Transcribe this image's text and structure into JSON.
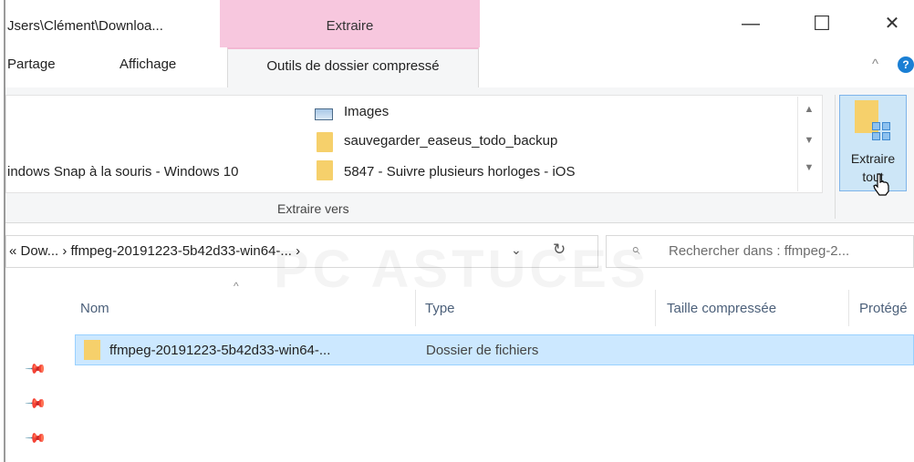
{
  "window": {
    "title": "Jsers\\Clément\\Downloa...",
    "context_tab": "Extraire",
    "minimize": "—",
    "maximize": "☐",
    "close": "✕"
  },
  "tabs": {
    "share": "Partage",
    "view": "Affichage",
    "active": "Outils de dossier compressé",
    "collapse": "^",
    "help": "?"
  },
  "ribbon": {
    "items": [
      {
        "label": "Images",
        "icon": "pictures-icon"
      },
      {
        "label": "sauvegarder_easeus_todo_backup",
        "icon": "folder-icon"
      },
      {
        "label": "5847 - Suivre plusieurs horloges - iOS",
        "icon": "folder-icon"
      }
    ],
    "left_item": "indows Snap à la souris - Windows 10",
    "group_label": "Extraire vers",
    "extract_all_line1": "Extraire",
    "extract_all_line2": "tout"
  },
  "address": {
    "path": "« Dow...  ›  ffmpeg-20191223-5b42d33-win64-...  ›",
    "dropdown": "⌄",
    "refresh": "↻",
    "search_placeholder": "Rechercher dans : ffmpeg-2..."
  },
  "watermark": "PC ASTUCES",
  "list": {
    "columns": [
      "Nom",
      "Type",
      "Taille compressée",
      "Protégé"
    ],
    "sort_caret": "^",
    "rows": [
      {
        "name": "ffmpeg-20191223-5b42d33-win64-...",
        "type": "Dossier de fichiers"
      }
    ]
  },
  "quick_access_pins": [
    "📌",
    "📌",
    "📌"
  ],
  "colors": {
    "context_pink": "#f7c7de",
    "selection": "#cce8ff",
    "folder": "#f6d06b",
    "accent": "#1a7fd4"
  }
}
